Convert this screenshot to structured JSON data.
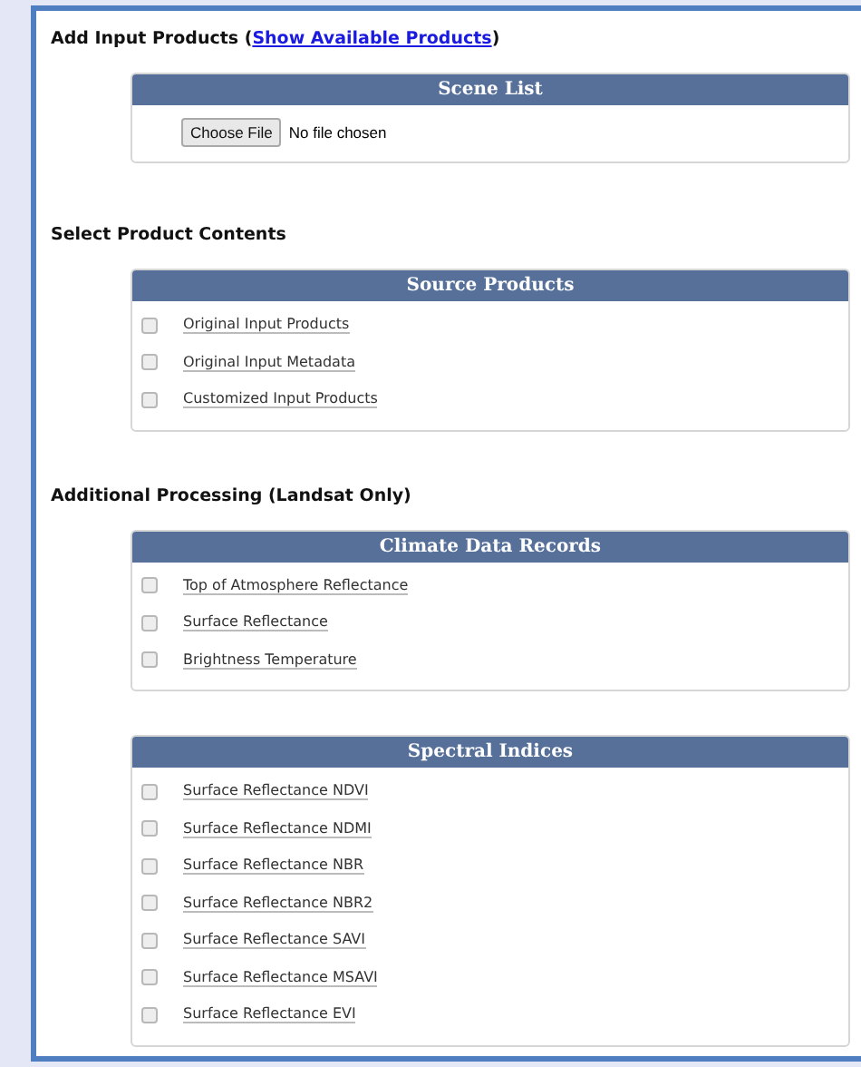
{
  "sections": [
    {
      "heading": {
        "prefix": "Add Input Products (",
        "link": "Show Available Products",
        "suffix": ")"
      },
      "panels": [
        {
          "title": "Scene List",
          "kind": "file",
          "button": "Choose File",
          "status": "No file chosen"
        }
      ]
    },
    {
      "heading": {
        "prefix": "Select Product Contents"
      },
      "panels": [
        {
          "title": "Source Products",
          "kind": "checklist",
          "options": [
            {
              "label": "Original Input Products",
              "checked": false
            },
            {
              "label": "Original Input Metadata",
              "checked": false
            },
            {
              "label": "Customized Input Products",
              "checked": false
            }
          ]
        }
      ]
    },
    {
      "heading": {
        "prefix": "Additional Processing (Landsat Only)"
      },
      "panels": [
        {
          "title": "Climate Data Records",
          "kind": "checklist",
          "options": [
            {
              "label": "Top of Atmosphere Reflectance",
              "checked": false
            },
            {
              "label": "Surface Reflectance",
              "checked": false
            },
            {
              "label": "Brightness Temperature",
              "checked": false
            }
          ]
        },
        {
          "title": "Spectral Indices",
          "kind": "checklist",
          "options": [
            {
              "label": "Surface Reflectance NDVI",
              "checked": false
            },
            {
              "label": "Surface Reflectance NDMI",
              "checked": false
            },
            {
              "label": "Surface Reflectance NBR",
              "checked": false
            },
            {
              "label": "Surface Reflectance NBR2",
              "checked": false
            },
            {
              "label": "Surface Reflectance SAVI",
              "checked": false
            },
            {
              "label": "Surface Reflectance MSAVI",
              "checked": false
            },
            {
              "label": "Surface Reflectance EVI",
              "checked": false
            }
          ]
        }
      ]
    }
  ]
}
